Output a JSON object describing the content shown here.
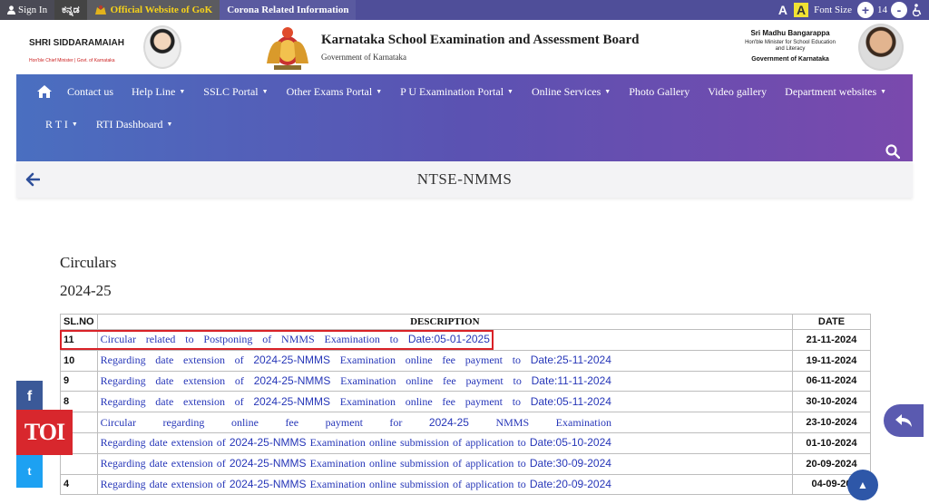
{
  "topbar": {
    "sign_in": "Sign In",
    "kannada": "ಕನ್ನಡ",
    "official": "Official Website of GoK",
    "corona": "Corona Related Information",
    "font_a_large": "A",
    "font_a_highlight": "A",
    "font_size_label": "Font Size",
    "plus": "+",
    "font_size_value": "14",
    "minus": "-"
  },
  "header": {
    "cm_name": "SHRI SIDDARAMAIAH",
    "cm_sub": "Hon'ble Chief Minister | Govt. of Karnataka",
    "title": "Karnataka School Examination and Assessment Board",
    "subtitle": "Government of Karnataka",
    "minister_name": "Sri Madhu Bangarappa",
    "minister_role_1": "Hon'ble Minister for School Education",
    "minister_role_2": "and Literacy",
    "minister_gov": "Government of Karnataka"
  },
  "nav": {
    "row1": [
      {
        "label": "Contact us",
        "dropdown": false
      },
      {
        "label": "Help Line",
        "dropdown": true
      },
      {
        "label": "SSLC Portal",
        "dropdown": true
      },
      {
        "label": "Other Exams Portal",
        "dropdown": true
      },
      {
        "label": "P U Examination Portal",
        "dropdown": true
      },
      {
        "label": "Online Services",
        "dropdown": true
      },
      {
        "label": "Photo Gallery",
        "dropdown": false
      },
      {
        "label": "Video gallery",
        "dropdown": false
      },
      {
        "label": "Department websites",
        "dropdown": true
      }
    ],
    "row2": [
      {
        "label": "R T I",
        "dropdown": true
      },
      {
        "label": "RTI Dashboard",
        "dropdown": true
      }
    ],
    "caret": "▼"
  },
  "page": {
    "title": "NTSE-NMMS",
    "circulars_heading": "Circulars",
    "year_heading": "2024-25"
  },
  "table": {
    "headers": {
      "sl": "SL.NO",
      "desc": "DESCRIPTION",
      "date": "DATE"
    },
    "rows": [
      {
        "sl": "11",
        "date": "21-11-2024",
        "words": [
          "Circular",
          "related",
          "to",
          "Postponing",
          "of",
          "NMMS",
          "Examination",
          "to",
          "Date:05-01-2025"
        ]
      },
      {
        "sl": "10",
        "date": "19-11-2024",
        "words": [
          "Regarding",
          "date",
          "extension",
          "of",
          "2024-25-NMMS",
          "Examination",
          "online",
          "fee",
          "payment",
          "to",
          "Date:25-11-2024"
        ]
      },
      {
        "sl": "9",
        "date": "06-11-2024",
        "words": [
          "Regarding",
          "date",
          "extension",
          "of",
          "2024-25-NMMS",
          "Examination",
          "online",
          "fee",
          "payment",
          "to",
          "Date:11-11-2024"
        ]
      },
      {
        "sl": "8",
        "date": "30-10-2024",
        "words": [
          "Regarding",
          "date",
          "extension",
          "of",
          "2024-25-NMMS",
          "Examination",
          "online",
          "fee",
          "payment",
          "to",
          "Date:05-11-2024"
        ]
      },
      {
        "sl": "",
        "date": "23-10-2024",
        "words": [
          "Circular",
          "regarding",
          "online",
          "fee",
          "payment",
          "for",
          "2024-25",
          "NMMS",
          "Examination"
        ]
      },
      {
        "sl": "",
        "date": "01-10-2024",
        "words": [
          "Regarding",
          "date",
          "extension",
          "of",
          "2024-25-NMMS",
          "Examination",
          "online",
          "submission",
          "of",
          "application",
          "to",
          "Date:05-10-2024"
        ]
      },
      {
        "sl": "",
        "date": "20-09-2024",
        "words": [
          "Regarding",
          "date",
          "extension",
          "of",
          "2024-25-NMMS",
          "Examination",
          "online",
          "submission",
          "of",
          "application",
          "to",
          "Date:30-09-2024"
        ]
      },
      {
        "sl": "4",
        "date": "04-09-20",
        "words": [
          "Regarding",
          "date",
          "extension",
          "of",
          "2024-25-NMMS",
          "Examination",
          "online",
          "submission",
          "of",
          "application",
          "to",
          "Date:20-09-2024"
        ]
      }
    ]
  },
  "overlay": {
    "fb": "f",
    "toi": "TOI",
    "tw": "t",
    "top": "▲"
  }
}
